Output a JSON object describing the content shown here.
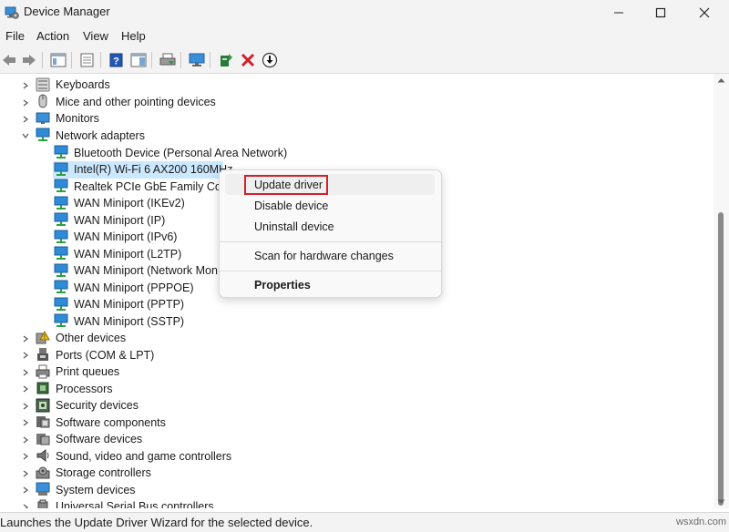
{
  "window": {
    "title": "Device Manager"
  },
  "menu": [
    "File",
    "Action",
    "View",
    "Help"
  ],
  "tree": {
    "categories_top": [
      {
        "label": "Keyboards",
        "icon": "keyboard-icon"
      },
      {
        "label": "Mice and other pointing devices",
        "icon": "mouse-icon"
      },
      {
        "label": "Monitors",
        "icon": "monitor-icon"
      },
      {
        "label": "Network adapters",
        "icon": "network-adapter-icon"
      }
    ],
    "network_adapters": [
      "Bluetooth Device (Personal Area Network)",
      "Intel(R) Wi-Fi 6 AX200 160MHz",
      "Realtek PCIe GbE Family Contr",
      "WAN Miniport (IKEv2)",
      "WAN Miniport (IP)",
      "WAN Miniport (IPv6)",
      "WAN Miniport (L2TP)",
      "WAN Miniport (Network Mon",
      "WAN Miniport (PPPOE)",
      "WAN Miniport (PPTP)",
      "WAN Miniport (SSTP)"
    ],
    "categories_bottom": [
      {
        "label": "Other devices",
        "icon": "unknown-device-icon"
      },
      {
        "label": "Ports (COM & LPT)",
        "icon": "port-icon"
      },
      {
        "label": "Print queues",
        "icon": "printer-icon"
      },
      {
        "label": "Processors",
        "icon": "processor-icon"
      },
      {
        "label": "Security devices",
        "icon": "security-device-icon"
      },
      {
        "label": "Software components",
        "icon": "software-component-icon"
      },
      {
        "label": "Software devices",
        "icon": "software-device-icon"
      },
      {
        "label": "Sound, video and game controllers",
        "icon": "speaker-icon"
      },
      {
        "label": "Storage controllers",
        "icon": "storage-controller-icon"
      },
      {
        "label": "System devices",
        "icon": "system-device-icon"
      },
      {
        "label": "Universal Serial Bus controllers",
        "icon": "usb-icon"
      }
    ]
  },
  "context_menu": {
    "update_driver": "Update driver",
    "disable_device": "Disable device",
    "uninstall_device": "Uninstall device",
    "scan": "Scan for hardware changes",
    "properties": "Properties"
  },
  "status_bar": {
    "text": "Launches the Update Driver Wizard for the selected device."
  },
  "watermark": "wsxdn.com",
  "colors": {
    "selection": "#cce8ff",
    "highlight_box": "#d3202a",
    "net_icon": "#2e8bd8"
  }
}
